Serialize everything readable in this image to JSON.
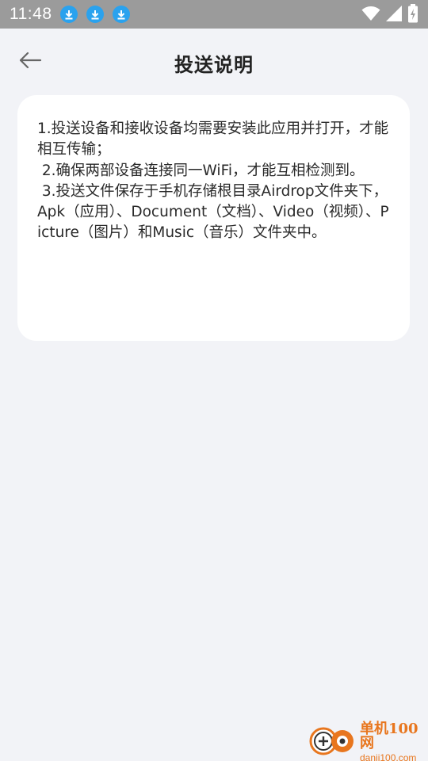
{
  "status_bar": {
    "time": "11:48",
    "notifications": [
      "download-icon",
      "download-icon",
      "download-icon"
    ],
    "accent": "#2aa2ee"
  },
  "header": {
    "title": "投送说明"
  },
  "instructions": [
    "1.投送设备和接收设备均需要安装此应用并打开，才能相互传输；",
    " 2.确保两部设备连接同一WiFi，才能互相检测到。",
    " 3.投送文件保存于手机存储根目录Airdrop文件夹下，Apk（应用）、Document（文档）、Video（视频）、Picture（图片）和Music（音乐）文件夹中。"
  ],
  "watermark": {
    "name": "单机100网",
    "url": "danji100.com",
    "color": "#e8761e"
  }
}
